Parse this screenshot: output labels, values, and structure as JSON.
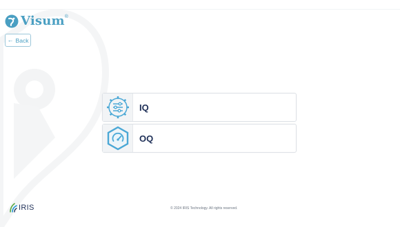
{
  "app": {
    "name": "Visum",
    "registered": "®"
  },
  "nav": {
    "back_label": "Back",
    "back_icon": "arrow-left-icon"
  },
  "cards": [
    {
      "label": "IQ",
      "icon": "gear-sliders-icon"
    },
    {
      "label": "OQ",
      "icon": "hexagon-gauge-icon"
    }
  ],
  "footer": {
    "brand": "IRIS",
    "copyright": "© 2024 IRIS Technology. All rights reserved."
  },
  "colors": {
    "brand": "#4a9fc2",
    "text": "#1e2f57",
    "icon_bg": "#f2f4f6",
    "border": "#dde1e6"
  }
}
